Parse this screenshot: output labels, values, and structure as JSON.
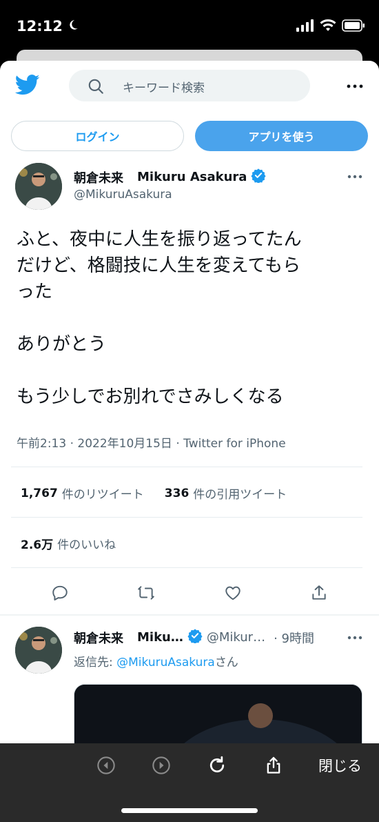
{
  "status_bar": {
    "time": "12:12",
    "icons": [
      "moon-icon",
      "cellular-signal-icon",
      "wifi-icon",
      "battery-icon"
    ]
  },
  "header": {
    "logo": "twitter-bird-icon",
    "search_placeholder": "キーワード検索",
    "more": "more-horizontal-icon"
  },
  "auth": {
    "login_label": "ログイン",
    "app_label": "アプリを使う"
  },
  "tweet": {
    "display_name": "朝倉未来",
    "name_en": "Mikuru Asakura",
    "handle": "@MikuruAsakura",
    "text_lines": [
      "ふと、夜中に人生を振り返ってたん",
      "だけど、格闘技に人生を変えてもら",
      "った",
      "ありがとう",
      "もう少しでお別れでさみしくなる"
    ],
    "meta": "午前2:13 · 2022年10月15日 · Twitter for iPhone",
    "stats": {
      "retweets_count": "1,767",
      "retweets_label": "件のリツイート",
      "quotes_count": "336",
      "quotes_label": "件の引用ツイート",
      "likes_count": "2.6万",
      "likes_label": "件のいいね"
    }
  },
  "reply": {
    "display_name": "朝倉未来",
    "name_truncated": "Miku…",
    "handle_truncated": "@Mikur…",
    "time": "· 9時間",
    "reply_prefix": "返信先: ",
    "reply_handle": "@MikuruAsakura",
    "reply_suffix": "さん"
  },
  "browser_bar": {
    "close_label": "閉じる"
  },
  "colors": {
    "accent": "#1d9bf0",
    "app_button": "#4aa3ec",
    "secondary_text": "#536471",
    "toolbar": "#2a2a2a"
  }
}
